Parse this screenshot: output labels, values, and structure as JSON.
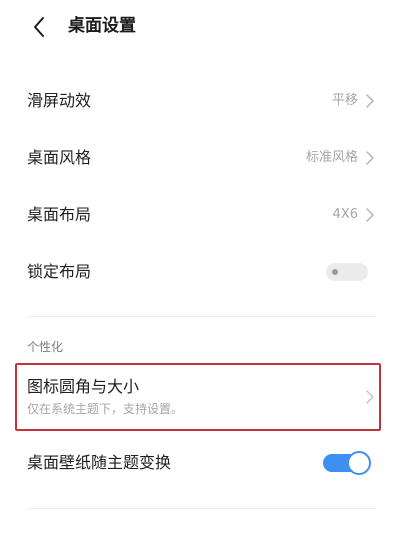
{
  "header": {
    "back_icon": "chevron-left-icon",
    "title": "桌面设置"
  },
  "settings": {
    "scroll_effect": {
      "label": "滑屏动效",
      "value": "平移"
    },
    "desktop_style": {
      "label": "桌面风格",
      "value": "标准风格"
    },
    "desktop_layout": {
      "label": "桌面布局",
      "value": "4X6"
    },
    "lock_layout": {
      "label": "锁定布局",
      "enabled": false
    }
  },
  "personalization": {
    "section_title": "个性化",
    "icon_corner_size": {
      "label": "图标圆角与大小",
      "description": "仅在系统主题下，支持设置。"
    },
    "wallpaper_follow_theme": {
      "label": "桌面壁纸随主题变换",
      "enabled": true
    }
  },
  "colors": {
    "accent": "#3f8ff3",
    "highlight_border": "#c2333c",
    "secondary_text": "#a6a6a6"
  }
}
